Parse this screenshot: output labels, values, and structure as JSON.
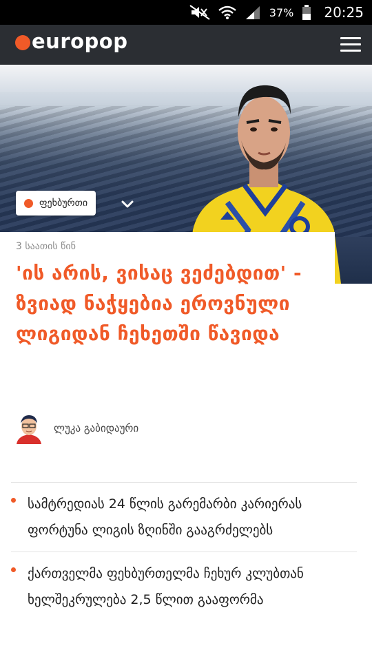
{
  "status_bar": {
    "battery_percent": "37%",
    "time": "20:25",
    "icons": [
      "mute-icon",
      "wifi-icon",
      "signal-icon",
      "battery-icon"
    ]
  },
  "header": {
    "logo_text": "europop",
    "accent_color": "#f05a28",
    "menu_icon": "hamburger-icon"
  },
  "hero": {
    "category_label": "ფეხბურთი",
    "toggle_icon": "chevron-down-icon"
  },
  "article": {
    "timestamp": "3 საათის წინ",
    "title": "'ის არის, ვისაც ვეძებდით' - ზვიად ნაჭყებია ეროვნული ლიგიდან ჩეხეთში წავიდა",
    "author_name": "ლუკა გაბიდაური"
  },
  "related": [
    {
      "text": "სამტრედიას 24 წლის გარემარბი კარიერას ფორტუნა ლიგის ზღინში გააგრძელებს"
    },
    {
      "text": "ქართველმა ფეხბურთელმა ჩეხურ კლუბთან ხელშეკრულება 2,5 წლით გააფორმა"
    }
  ]
}
